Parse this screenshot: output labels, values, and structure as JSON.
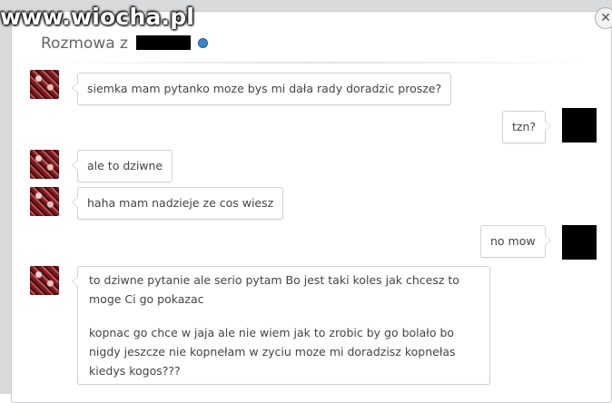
{
  "watermark": "www.wiocha.pl",
  "header": {
    "title": "Rozmowa z"
  },
  "messages": [
    {
      "side": "left",
      "text": "siemka mam pytanko moze bys mi dała rady doradzic prosze?"
    },
    {
      "side": "right",
      "text": "tzn?"
    },
    {
      "side": "left",
      "text": "ale to dziwne"
    },
    {
      "side": "left",
      "text": "haha mam nadzieje ze cos wiesz"
    },
    {
      "side": "right",
      "text": "no mow"
    },
    {
      "side": "left",
      "paragraphs": [
        "to dziwne pytanie ale serio pytam Bo jest taki koles jak chcesz to moge Ci go pokazac",
        "kopnac go chce w jaja ale nie wiem jak to zrobic by go bolało bo nigdy jeszcze nie kopnełam w zyciu moze mi doradzisz kopnełas kiedys kogos???"
      ]
    }
  ],
  "icons": {
    "close": "close-icon",
    "online": "online-status-icon"
  },
  "colors": {
    "background": "#ffffff",
    "accent": "#3a86c8",
    "bubble_border": "#cfd2d4"
  }
}
